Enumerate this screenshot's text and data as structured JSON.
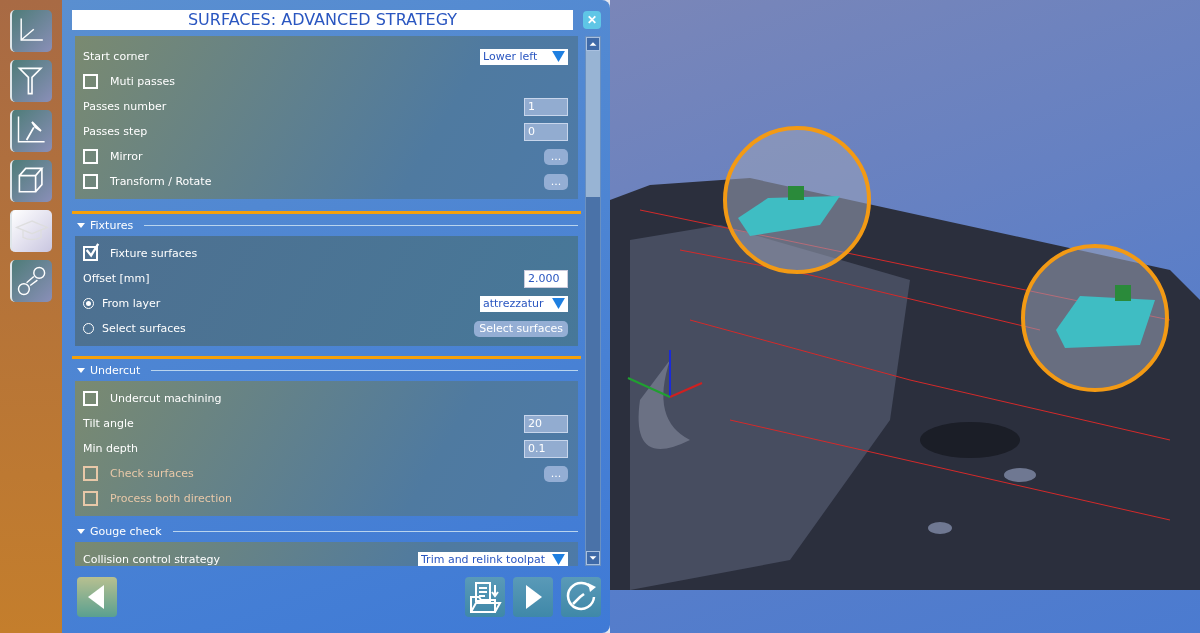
{
  "toolbar": [
    {
      "selected": false
    },
    {
      "selected": false
    },
    {
      "selected": false
    },
    {
      "selected": false
    },
    {
      "selected": true
    },
    {
      "selected": false
    }
  ],
  "dialog": {
    "title": "SURFACES: ADVANCED STRATEGY",
    "close": "✕",
    "sections": [
      {
        "rows": [
          {
            "kind": "dropdown",
            "label": "Start corner",
            "value": "Lower left"
          },
          {
            "kind": "checkbox",
            "label": "Muti passes",
            "checked": false,
            "disabled": false
          },
          {
            "kind": "number",
            "label": "Passes number",
            "value": "1",
            "disabled": true
          },
          {
            "kind": "number",
            "label": "Passes step",
            "value": "0",
            "disabled": true
          },
          {
            "kind": "checkbox",
            "label": "Mirror",
            "checked": false,
            "disabled": false,
            "button": "...",
            "button_disabled": true
          },
          {
            "kind": "checkbox",
            "label": "Transform / Rotate",
            "checked": false,
            "disabled": false,
            "button": "...",
            "button_disabled": true
          }
        ]
      },
      {
        "title": "Fixtures",
        "expanded": true,
        "highlighted": true,
        "rows": [
          {
            "kind": "checkbox",
            "label": "Fixture surfaces",
            "checked": true,
            "disabled": false
          },
          {
            "kind": "number",
            "label": "Offset [mm]",
            "value": "2.000",
            "disabled": false
          },
          {
            "kind": "radio",
            "label": "From layer",
            "selected": true,
            "value": "attrezzatur"
          },
          {
            "kind": "radio",
            "label": "Select surfaces",
            "selected": false,
            "button": "Select surfaces",
            "button_disabled": true
          }
        ]
      },
      {
        "title": "Undercut",
        "expanded": true,
        "rows": [
          {
            "kind": "checkbox",
            "label": "Undercut machining",
            "checked": false,
            "disabled": false
          },
          {
            "kind": "number",
            "label": "Tilt angle",
            "value": "20",
            "disabled": true
          },
          {
            "kind": "number",
            "label": "Min depth",
            "value": "0.1",
            "disabled": true
          },
          {
            "kind": "checkbox",
            "label": "Check surfaces",
            "checked": false,
            "disabled": true,
            "button": "...",
            "button_disabled": true
          },
          {
            "kind": "checkbox",
            "label": "Process both direction",
            "checked": false,
            "disabled": true
          }
        ]
      },
      {
        "title": "Gouge check",
        "expanded": true,
        "rows": [
          {
            "kind": "dropdown",
            "label": "Collision control strategy",
            "value": "Trim and relink toolpat"
          }
        ]
      }
    ]
  }
}
